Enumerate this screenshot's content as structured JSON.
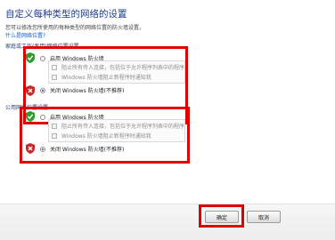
{
  "page": {
    "title": "自定义每种类型的网络的设置",
    "description": "您可以修改您所使用的每种类型的网络位置的防火墙设置。",
    "link": "什么是网络位置?"
  },
  "home_section": {
    "header": "家庭或工作(专用)网络位置设置",
    "enable_label": "启用 Windows 防火墙",
    "block_all_label": "阻止所有传入连接，包括位于允许程序列表中的程序",
    "notify_label": "Windows 防火墙阻止新程序时通知我",
    "disable_label": "关闭 Windows 防火墙(不推荐)"
  },
  "public_section": {
    "header": "公用网络位置设置",
    "enable_label": "启用 Windows 防火墙",
    "block_all_label": "阻止所有传入连接，包括位于允许程序列表中的程序",
    "notify_label": "Windows 防火墙阻止新程序时通知我",
    "disable_label": "关闭 Windows 防火墙(不推荐)"
  },
  "footer": {
    "ok_label": "确定",
    "cancel_label": "取消"
  },
  "colors": {
    "highlight": "#e10000",
    "title": "#1e3f8f",
    "link": "#0b5bd3"
  },
  "icons": {
    "enabled": "green-shield-check-icon",
    "disabled": "red-shield-x-icon"
  }
}
